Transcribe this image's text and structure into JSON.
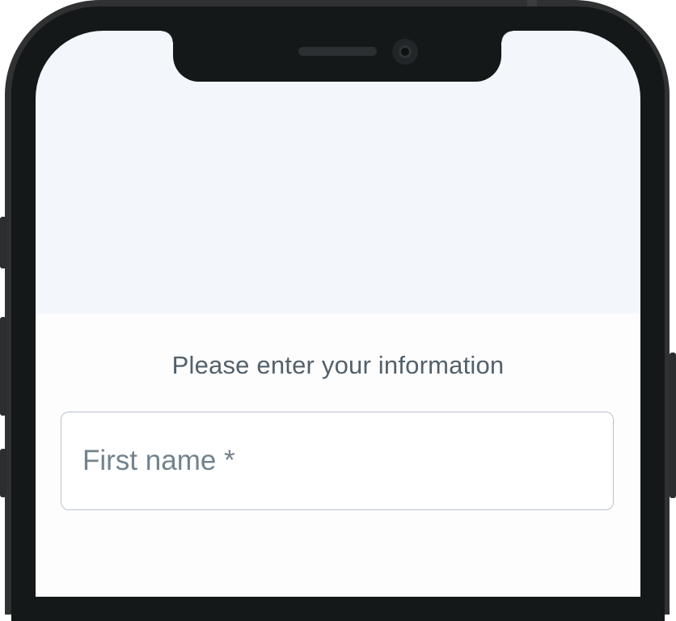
{
  "form": {
    "prompt": "Please enter your information",
    "first_name_label": "First name *"
  },
  "colors": {
    "phone_frame": "#2f3132",
    "phone_bezel": "#151819",
    "screen_header_bg": "#f3f6fb",
    "screen_body_bg": "#fdfdfe",
    "prompt_text": "#53616b",
    "field_border": "#b9c3ca",
    "field_label_text": "#73828d"
  }
}
